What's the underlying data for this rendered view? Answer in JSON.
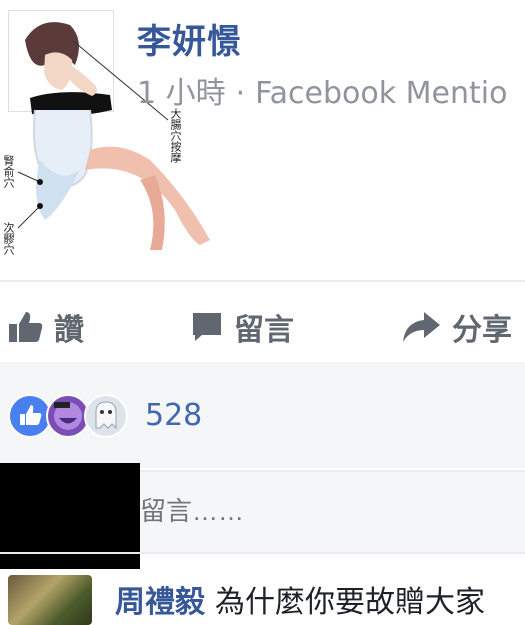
{
  "post": {
    "author": "李妍憬",
    "time": "1 小時",
    "separator": "·",
    "source": "Facebook Mentio",
    "annotations": [
      "大腸穴按摩",
      "腎俞穴",
      "次髎穴"
    ]
  },
  "actions": {
    "like": "讚",
    "comment": "留言",
    "share": "分享"
  },
  "reactions": {
    "count": "528"
  },
  "comment_input": {
    "placeholder": "留言……"
  },
  "comments": [
    {
      "name": "周禮毅",
      "text": "為什麼你要故贈大家"
    }
  ],
  "colors": {
    "link": "#365899",
    "meta": "#90949c",
    "like_blue": "#4267b2"
  }
}
